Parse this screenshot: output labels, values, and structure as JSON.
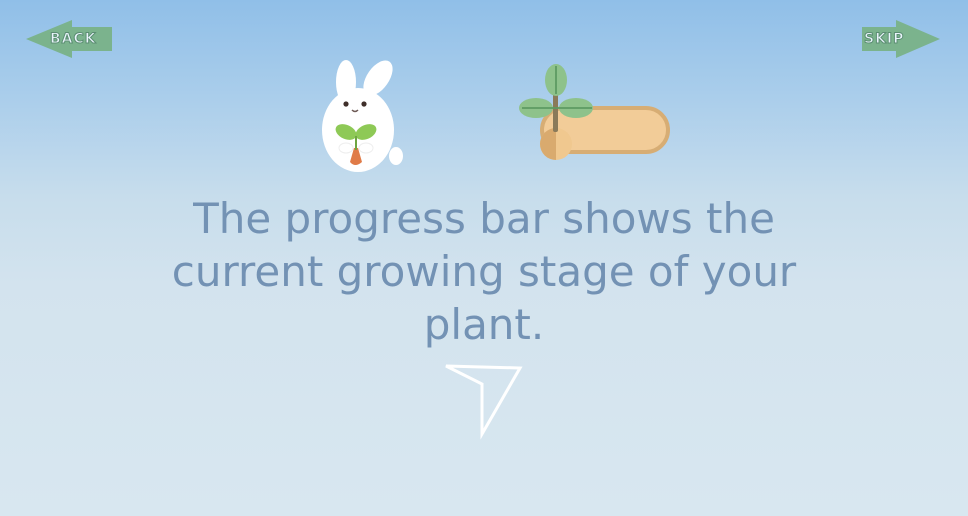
{
  "nav": {
    "back_label": "BACK",
    "skip_label": "SKIP"
  },
  "tutorial": {
    "message": "The progress bar shows the current growing stage of your plant."
  },
  "icons": {
    "back": "left-arrow-icon",
    "skip": "right-arrow-icon",
    "bunny": "bunny-holding-sprout-icon",
    "progress": "sprout-progress-bar",
    "next": "down-arrow-icon"
  },
  "colors": {
    "sky_top": "#90bfe8",
    "sky_bottom": "#d8e7f0",
    "text": "#7392b4",
    "nav_arrow": "#7bb38d",
    "progress_fill": "#f2cc98",
    "progress_border": "#d7ad74",
    "leaf": "#8ec28b"
  }
}
